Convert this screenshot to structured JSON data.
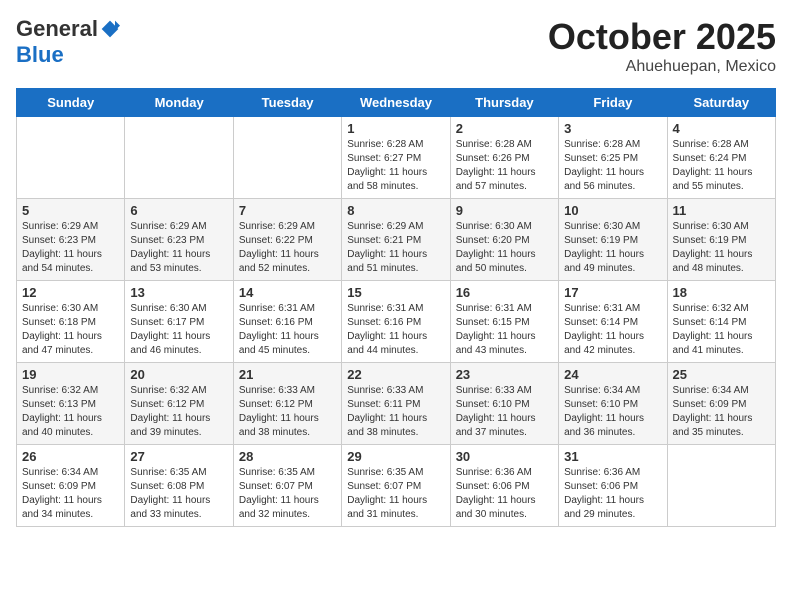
{
  "header": {
    "logo_general": "General",
    "logo_blue": "Blue",
    "month": "October 2025",
    "location": "Ahuehuepan, Mexico"
  },
  "days_of_week": [
    "Sunday",
    "Monday",
    "Tuesday",
    "Wednesday",
    "Thursday",
    "Friday",
    "Saturday"
  ],
  "weeks": [
    [
      {
        "day": "",
        "sunrise": "",
        "sunset": "",
        "daylight": ""
      },
      {
        "day": "",
        "sunrise": "",
        "sunset": "",
        "daylight": ""
      },
      {
        "day": "",
        "sunrise": "",
        "sunset": "",
        "daylight": ""
      },
      {
        "day": "1",
        "sunrise": "Sunrise: 6:28 AM",
        "sunset": "Sunset: 6:27 PM",
        "daylight": "Daylight: 11 hours and 58 minutes."
      },
      {
        "day": "2",
        "sunrise": "Sunrise: 6:28 AM",
        "sunset": "Sunset: 6:26 PM",
        "daylight": "Daylight: 11 hours and 57 minutes."
      },
      {
        "day": "3",
        "sunrise": "Sunrise: 6:28 AM",
        "sunset": "Sunset: 6:25 PM",
        "daylight": "Daylight: 11 hours and 56 minutes."
      },
      {
        "day": "4",
        "sunrise": "Sunrise: 6:28 AM",
        "sunset": "Sunset: 6:24 PM",
        "daylight": "Daylight: 11 hours and 55 minutes."
      }
    ],
    [
      {
        "day": "5",
        "sunrise": "Sunrise: 6:29 AM",
        "sunset": "Sunset: 6:23 PM",
        "daylight": "Daylight: 11 hours and 54 minutes."
      },
      {
        "day": "6",
        "sunrise": "Sunrise: 6:29 AM",
        "sunset": "Sunset: 6:23 PM",
        "daylight": "Daylight: 11 hours and 53 minutes."
      },
      {
        "day": "7",
        "sunrise": "Sunrise: 6:29 AM",
        "sunset": "Sunset: 6:22 PM",
        "daylight": "Daylight: 11 hours and 52 minutes."
      },
      {
        "day": "8",
        "sunrise": "Sunrise: 6:29 AM",
        "sunset": "Sunset: 6:21 PM",
        "daylight": "Daylight: 11 hours and 51 minutes."
      },
      {
        "day": "9",
        "sunrise": "Sunrise: 6:30 AM",
        "sunset": "Sunset: 6:20 PM",
        "daylight": "Daylight: 11 hours and 50 minutes."
      },
      {
        "day": "10",
        "sunrise": "Sunrise: 6:30 AM",
        "sunset": "Sunset: 6:19 PM",
        "daylight": "Daylight: 11 hours and 49 minutes."
      },
      {
        "day": "11",
        "sunrise": "Sunrise: 6:30 AM",
        "sunset": "Sunset: 6:19 PM",
        "daylight": "Daylight: 11 hours and 48 minutes."
      }
    ],
    [
      {
        "day": "12",
        "sunrise": "Sunrise: 6:30 AM",
        "sunset": "Sunset: 6:18 PM",
        "daylight": "Daylight: 11 hours and 47 minutes."
      },
      {
        "day": "13",
        "sunrise": "Sunrise: 6:30 AM",
        "sunset": "Sunset: 6:17 PM",
        "daylight": "Daylight: 11 hours and 46 minutes."
      },
      {
        "day": "14",
        "sunrise": "Sunrise: 6:31 AM",
        "sunset": "Sunset: 6:16 PM",
        "daylight": "Daylight: 11 hours and 45 minutes."
      },
      {
        "day": "15",
        "sunrise": "Sunrise: 6:31 AM",
        "sunset": "Sunset: 6:16 PM",
        "daylight": "Daylight: 11 hours and 44 minutes."
      },
      {
        "day": "16",
        "sunrise": "Sunrise: 6:31 AM",
        "sunset": "Sunset: 6:15 PM",
        "daylight": "Daylight: 11 hours and 43 minutes."
      },
      {
        "day": "17",
        "sunrise": "Sunrise: 6:31 AM",
        "sunset": "Sunset: 6:14 PM",
        "daylight": "Daylight: 11 hours and 42 minutes."
      },
      {
        "day": "18",
        "sunrise": "Sunrise: 6:32 AM",
        "sunset": "Sunset: 6:14 PM",
        "daylight": "Daylight: 11 hours and 41 minutes."
      }
    ],
    [
      {
        "day": "19",
        "sunrise": "Sunrise: 6:32 AM",
        "sunset": "Sunset: 6:13 PM",
        "daylight": "Daylight: 11 hours and 40 minutes."
      },
      {
        "day": "20",
        "sunrise": "Sunrise: 6:32 AM",
        "sunset": "Sunset: 6:12 PM",
        "daylight": "Daylight: 11 hours and 39 minutes."
      },
      {
        "day": "21",
        "sunrise": "Sunrise: 6:33 AM",
        "sunset": "Sunset: 6:12 PM",
        "daylight": "Daylight: 11 hours and 38 minutes."
      },
      {
        "day": "22",
        "sunrise": "Sunrise: 6:33 AM",
        "sunset": "Sunset: 6:11 PM",
        "daylight": "Daylight: 11 hours and 38 minutes."
      },
      {
        "day": "23",
        "sunrise": "Sunrise: 6:33 AM",
        "sunset": "Sunset: 6:10 PM",
        "daylight": "Daylight: 11 hours and 37 minutes."
      },
      {
        "day": "24",
        "sunrise": "Sunrise: 6:34 AM",
        "sunset": "Sunset: 6:10 PM",
        "daylight": "Daylight: 11 hours and 36 minutes."
      },
      {
        "day": "25",
        "sunrise": "Sunrise: 6:34 AM",
        "sunset": "Sunset: 6:09 PM",
        "daylight": "Daylight: 11 hours and 35 minutes."
      }
    ],
    [
      {
        "day": "26",
        "sunrise": "Sunrise: 6:34 AM",
        "sunset": "Sunset: 6:09 PM",
        "daylight": "Daylight: 11 hours and 34 minutes."
      },
      {
        "day": "27",
        "sunrise": "Sunrise: 6:35 AM",
        "sunset": "Sunset: 6:08 PM",
        "daylight": "Daylight: 11 hours and 33 minutes."
      },
      {
        "day": "28",
        "sunrise": "Sunrise: 6:35 AM",
        "sunset": "Sunset: 6:07 PM",
        "daylight": "Daylight: 11 hours and 32 minutes."
      },
      {
        "day": "29",
        "sunrise": "Sunrise: 6:35 AM",
        "sunset": "Sunset: 6:07 PM",
        "daylight": "Daylight: 11 hours and 31 minutes."
      },
      {
        "day": "30",
        "sunrise": "Sunrise: 6:36 AM",
        "sunset": "Sunset: 6:06 PM",
        "daylight": "Daylight: 11 hours and 30 minutes."
      },
      {
        "day": "31",
        "sunrise": "Sunrise: 6:36 AM",
        "sunset": "Sunset: 6:06 PM",
        "daylight": "Daylight: 11 hours and 29 minutes."
      },
      {
        "day": "",
        "sunrise": "",
        "sunset": "",
        "daylight": ""
      }
    ]
  ]
}
